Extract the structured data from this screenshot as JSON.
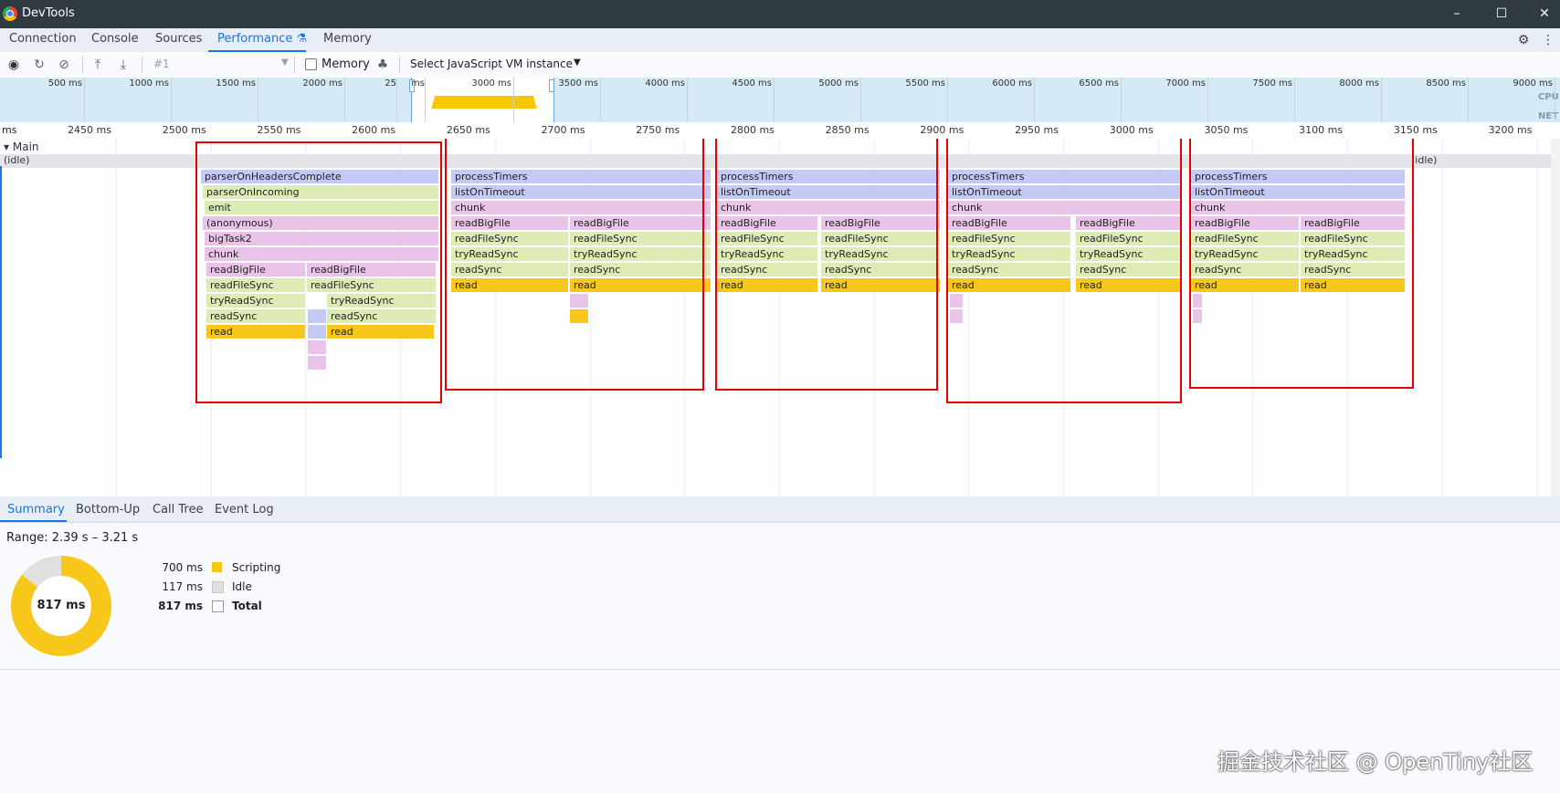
{
  "window": {
    "title": "DevTools",
    "controls": [
      "–",
      "☐",
      "✕"
    ]
  },
  "tabs": [
    {
      "label": "Connection",
      "active": false
    },
    {
      "label": "Console",
      "active": false
    },
    {
      "label": "Sources",
      "active": false
    },
    {
      "label": "Performance ⚗",
      "active": true
    },
    {
      "label": "Memory",
      "active": false
    }
  ],
  "toolbar": {
    "profile": "#1",
    "memory_label": "Memory",
    "vm_select": "Select JavaScript VM instance"
  },
  "overview": {
    "ticks": [
      "500 ms",
      "1000 ms",
      "1500 ms",
      "2000 ms",
      "25",
      "ms",
      "3000 ms",
      "3500 ms",
      "4000 ms",
      "4500 ms",
      "5000 ms",
      "5500 ms",
      "6000 ms",
      "6500 ms",
      "7000 ms",
      "7500 ms",
      "8000 ms",
      "8500 ms",
      "9000 ms"
    ],
    "cpu_label": "CPU",
    "net_label": "NET"
  },
  "ruler": {
    "start_label": "ms",
    "ticks": [
      "2450 ms",
      "2500 ms",
      "2550 ms",
      "2600 ms",
      "2650 ms",
      "2700 ms",
      "2750 ms",
      "2800 ms",
      "2850 ms",
      "2900 ms",
      "2950 ms",
      "3000 ms",
      "3050 ms",
      "3100 ms",
      "3150 ms",
      "3200 ms"
    ]
  },
  "flame": {
    "track": "Main",
    "idle_left": "(idle)",
    "idle_right": "(idle)",
    "colors": {
      "timers": "#c4c9f5",
      "green": "#dcecb4",
      "pink": "#e9c3e8",
      "read": "#f7c71a"
    },
    "group1": [
      "parserOnHeadersComplete",
      "parserOnIncoming",
      "emit",
      "(anonymous)",
      "bigTask2",
      "chunk",
      "readBigFile",
      "readBigFile",
      "readFileSync",
      "readFileSync",
      "tryReadSync",
      "tryReadSync",
      "readSync",
      "readSync",
      "read",
      "read"
    ],
    "group2": [
      "processTimers",
      "listOnTimeout",
      "chunk",
      "readBigFile",
      "readBigFile",
      "readFileSync",
      "readFileSync",
      "tryReadSync",
      "tryReadSync",
      "readSync",
      "readSync",
      "read",
      "read"
    ],
    "group3": [
      "processTimers",
      "listOnTimeout",
      "chunk",
      "readBigFile",
      "readBigFile",
      "readFileSync",
      "readFileSync",
      "tryReadSync",
      "tryReadSync",
      "readSync",
      "readSync",
      "read",
      "read"
    ],
    "group4": [
      "processTimers",
      "listOnTimeout",
      "chunk",
      "readBigFile",
      "readBigFile",
      "readFileSync",
      "readFileSync",
      "tryReadSync",
      "tryReadSync",
      "readSync",
      "readSync",
      "read",
      "read"
    ],
    "group5": [
      "processTimers",
      "listOnTimeout",
      "chunk",
      "readBigFile",
      "readBigFile",
      "readFileSync",
      "readFileSync",
      "tryReadSync",
      "tryReadSync",
      "readSync",
      "readSync",
      "read",
      "read"
    ]
  },
  "bottom_tabs": [
    {
      "label": "Summary",
      "active": true
    },
    {
      "label": "Bottom-Up",
      "active": false
    },
    {
      "label": "Call Tree",
      "active": false
    },
    {
      "label": "Event Log",
      "active": false
    }
  ],
  "summary": {
    "range": "Range: 2.39 s – 3.21 s",
    "total_center": "817 ms",
    "rows": [
      {
        "value": "700 ms",
        "label": "Scripting",
        "color": "#f7c71a"
      },
      {
        "value": "117 ms",
        "label": "Idle",
        "color": "#e0e0e0"
      },
      {
        "value": "817 ms",
        "label": "Total",
        "color": "#ffffff"
      }
    ]
  },
  "watermark": "掘金技术社区 @ OpenTiny社区"
}
